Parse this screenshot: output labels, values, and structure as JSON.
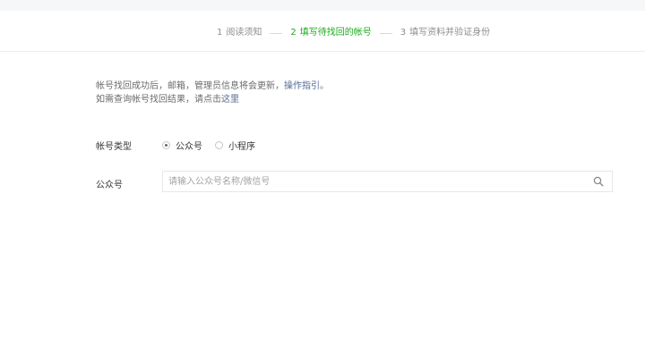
{
  "steps": [
    {
      "num": "1",
      "label": "阅读须知",
      "state": "done"
    },
    {
      "num": "2",
      "label": "填写待找回的帐号",
      "state": "active"
    },
    {
      "num": "3",
      "label": "填写资料并验证身份",
      "state": "pending"
    }
  ],
  "notice": {
    "line1_text": "帐号找回成功后，邮箱，管理员信息将会更新，",
    "line1_link": "操作指引",
    "line1_end": "。",
    "line2_text": "如需查询帐号找回结果，请点击",
    "line2_link": "这里"
  },
  "form": {
    "account_type_label": "帐号类型",
    "account_type_options": [
      {
        "label": "公众号",
        "checked": true
      },
      {
        "label": "小程序",
        "checked": false
      }
    ],
    "account_label": "公众号",
    "search_placeholder": "请输入公众号名称/微信号",
    "search_value": ""
  },
  "icons": {
    "search": "search-icon"
  },
  "colors": {
    "active_step": "#1aad19",
    "link": "#576b95",
    "muted_text": "#8d8d8d"
  }
}
